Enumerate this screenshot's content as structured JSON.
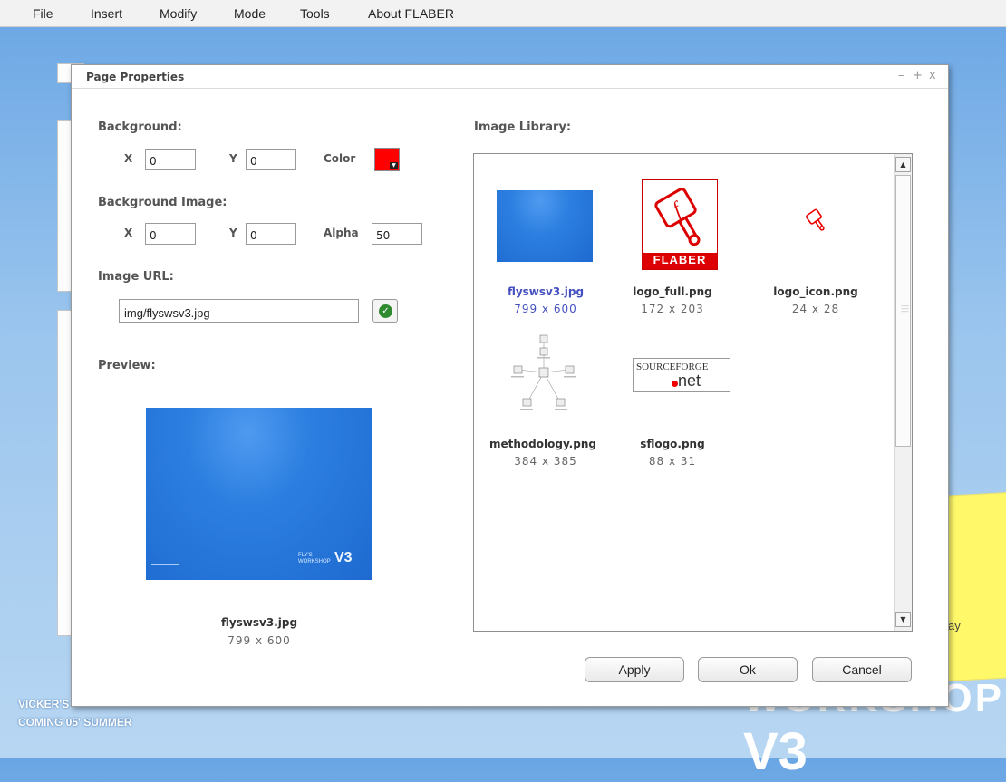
{
  "menubar": {
    "items": [
      "File",
      "Insert",
      "Modify",
      "Mode",
      "Tools",
      "About FLABER"
    ]
  },
  "background": {
    "caption_line1": "VICKER'S",
    "caption_line2": "COMING 05' SUMMER",
    "logo": "WORKSHOP",
    "logo_version": "V3",
    "sticky_text": "ay"
  },
  "dialog": {
    "title": "Page Properties",
    "controls": {
      "minimize": "–",
      "maximize": "+",
      "close": "x"
    },
    "background_section": {
      "label": "Background:",
      "x_label": "X",
      "x_value": "0",
      "y_label": "Y",
      "y_value": "0",
      "color_label": "Color",
      "color_value": "#ff0000"
    },
    "bg_image_section": {
      "label": "Background Image:",
      "x_label": "X",
      "x_value": "0",
      "y_label": "Y",
      "y_value": "0",
      "alpha_label": "Alpha",
      "alpha_value": "50"
    },
    "image_url": {
      "label": "Image URL:",
      "value": "img/flyswsv3.jpg"
    },
    "preview": {
      "label": "Preview:",
      "name": "flyswsv3.jpg",
      "size": "799 x 600",
      "wallpaper_brand": "FLY'S WORKSHOP",
      "wallpaper_version": "V3"
    },
    "library": {
      "label": "Image Library:",
      "items": [
        {
          "name": "flyswsv3.jpg",
          "size": "799 x 600",
          "selected": true
        },
        {
          "name": "logo_full.png",
          "size": "172 x 203",
          "brand": "FLABER"
        },
        {
          "name": "logo_icon.png",
          "size": "24 x 28"
        },
        {
          "name": "methodology.png",
          "size": "384 x 385"
        },
        {
          "name": "sflogo.png",
          "size": "88 x 31",
          "brand_a": "SOURCEFORGE",
          "brand_b": ".net"
        }
      ]
    },
    "buttons": {
      "apply": "Apply",
      "ok": "Ok",
      "cancel": "Cancel"
    }
  }
}
